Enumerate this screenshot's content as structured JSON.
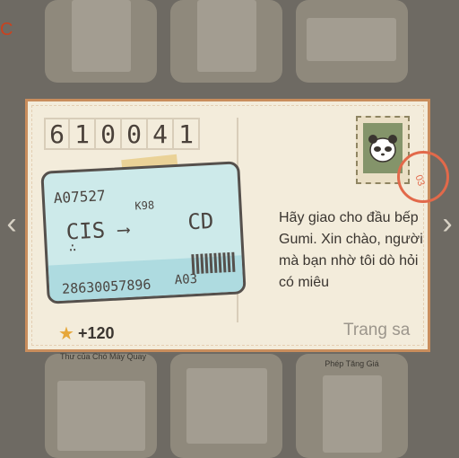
{
  "postcard": {
    "postcode": [
      "6",
      "1",
      "0",
      "0",
      "4",
      "1"
    ],
    "ticket": {
      "code_top": "A07527",
      "flight": "K98",
      "from": "CIS",
      "to": "CD",
      "number": "28630057896",
      "gate": "A03"
    },
    "reward": "+120",
    "message": "Hãy giao cho đầu bếp Gumi. Xin chào, người mà bạn nhờ tôi dò hỏi có miêu",
    "next_page": "Trang sa"
  },
  "background": {
    "captions": [
      "Thư của Chó Máy Quay",
      "Phép Tăng Giá"
    ],
    "edge_text": "C"
  },
  "colors": {
    "card_border": "#c98d5c",
    "ticket_bg": "#cdeaea",
    "star": "#e6a73a",
    "postmark": "#e2694a"
  },
  "icons": [
    "star-icon",
    "panda-stamp-icon",
    "arrow-right-icon"
  ]
}
